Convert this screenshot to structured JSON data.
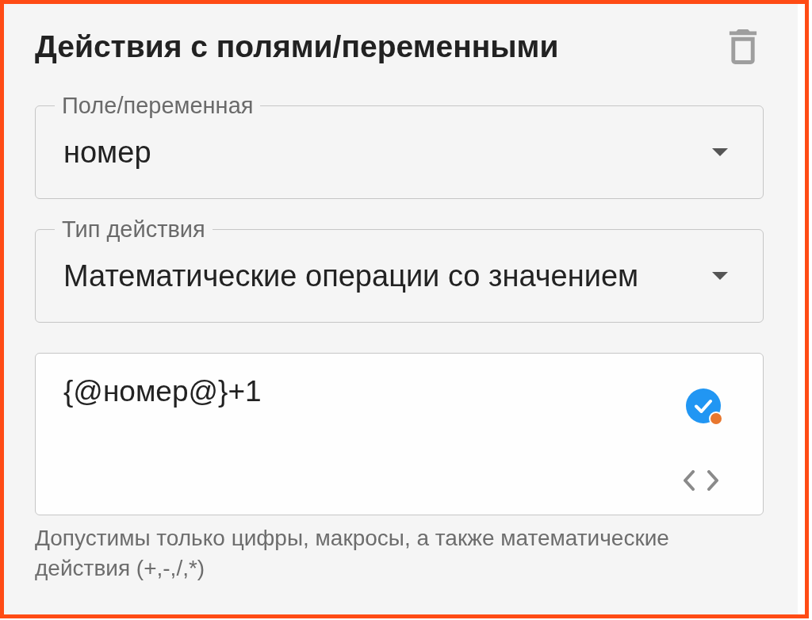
{
  "title": "Действия с полями/переменными",
  "fields": [
    {
      "label": "Поле/переменная",
      "value": "номер"
    },
    {
      "label": "Тип действия",
      "value": "Математические операции со значением"
    }
  ],
  "expression": {
    "value": "{@номер@}+1"
  },
  "helper_text": "Допустимы только цифры, макросы, а также математические действия (+,-,/,*)"
}
